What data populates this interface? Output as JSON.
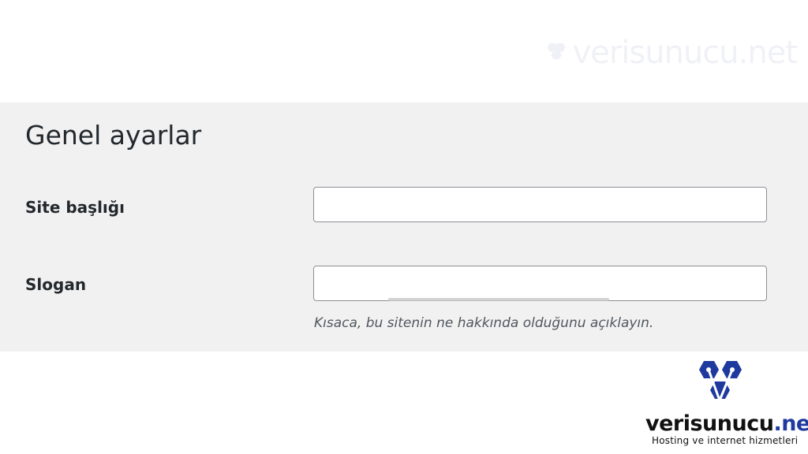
{
  "watermark": {
    "text": "verisunucu.net",
    "icon": "hexagon-logo-icon"
  },
  "settings": {
    "title": "Genel ayarlar",
    "fields": [
      {
        "label": "Site başlığı",
        "value": "",
        "placeholder": ""
      },
      {
        "label": "Slogan",
        "value": "",
        "placeholder": "",
        "description": "Kısaca, bu sitenin ne hakkında olduğunu açıklayın."
      }
    ]
  },
  "brand": {
    "name_main": "verisunucu",
    "name_tld": ".net",
    "tagline": "Hosting ve internet hizmetleri",
    "icon": "hexagon-logo-icon",
    "color": "#1f3a9e"
  },
  "colors": {
    "panel_bg": "#f1f1f1",
    "input_border": "#8c8f94",
    "text": "#23282d",
    "description": "#50575e",
    "brand_blue": "#1f3a9e"
  }
}
